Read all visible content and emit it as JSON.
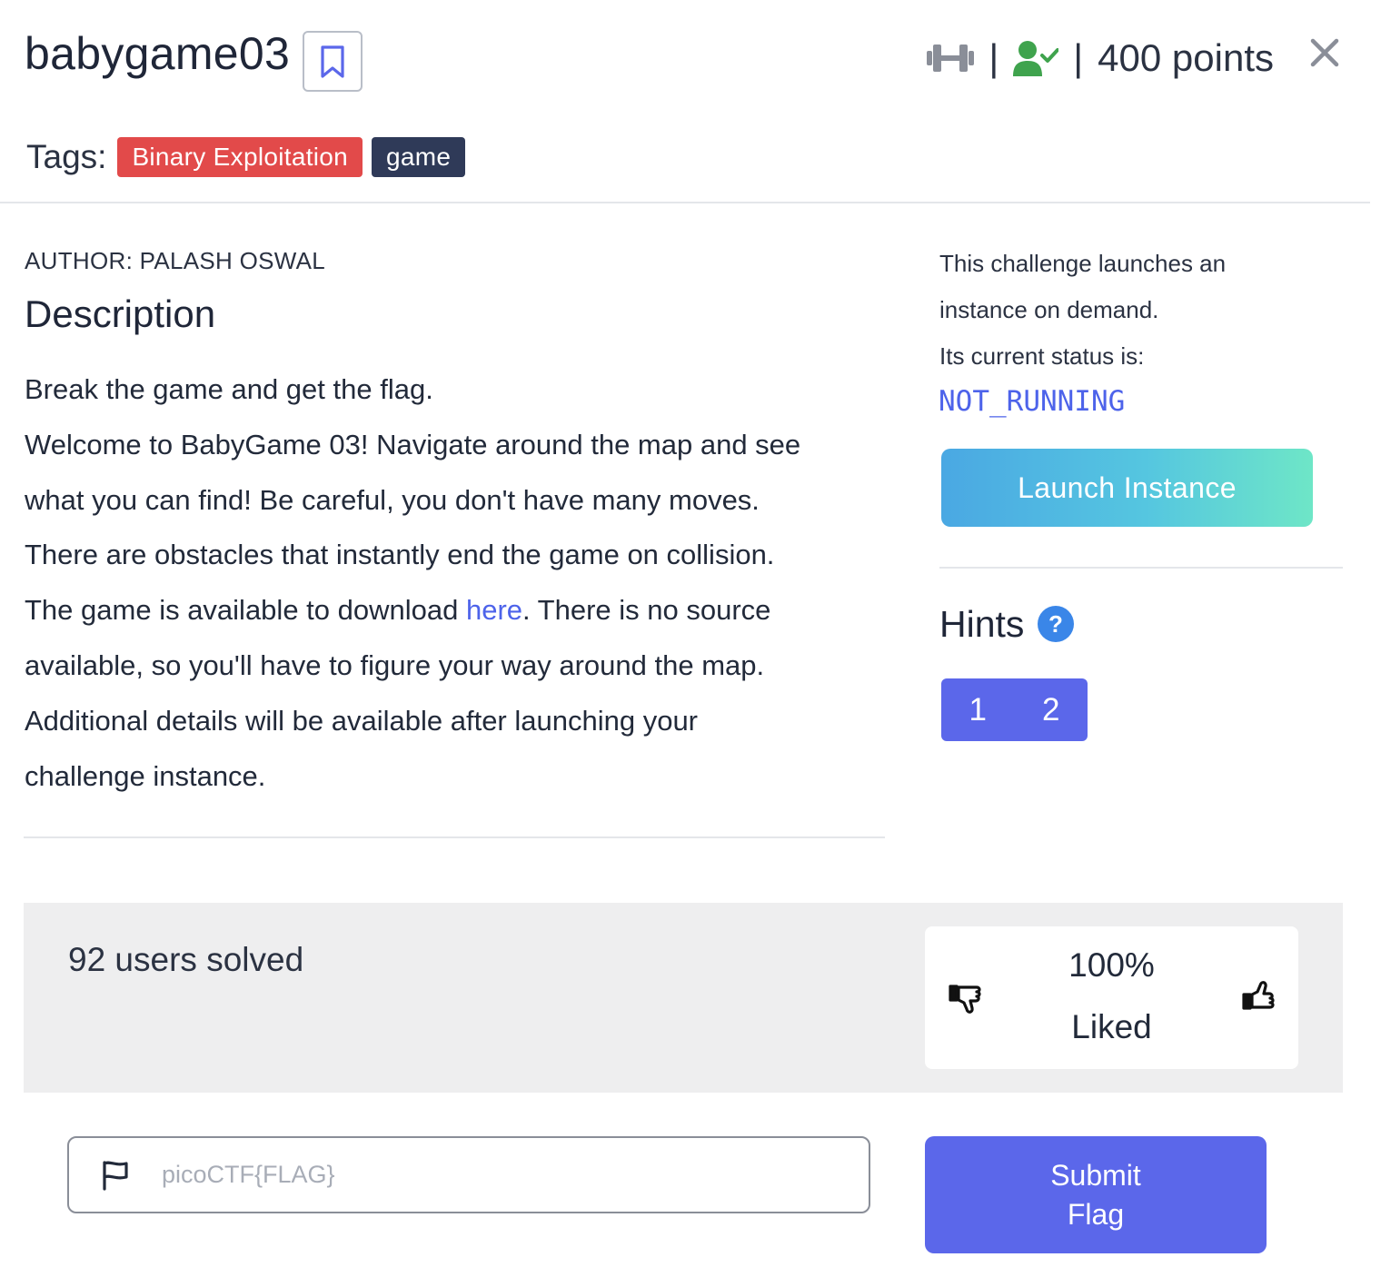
{
  "challenge": {
    "title": "babygame03",
    "points": "400 points",
    "separator": "|"
  },
  "tags": {
    "label": "Tags:",
    "items": [
      "Binary Exploitation",
      "game"
    ],
    "colors": [
      "#e24a4a",
      "#2f3a58"
    ]
  },
  "description": {
    "author": "AUTHOR: PALASH OSWAL",
    "heading": "Description",
    "line1": "Break the game and get the flag.",
    "line2": "Welcome to BabyGame 03! Navigate around the map and see",
    "line3": "what you can find! Be careful, you don't have many moves.",
    "line4": "There are obstacles that instantly end the game on collision.",
    "line5_before_link": "The game is available to download ",
    "link_text": "here",
    "line5_after_link": ". There is no source",
    "line6": "available, so you'll have to figure your way around the map.",
    "line7": "Additional details will be available after launching your",
    "line8": "challenge instance."
  },
  "instance": {
    "text_line1": "This challenge launches an",
    "text_line2": "instance on demand.",
    "text_line3": "Its current status is:",
    "status": "NOT_RUNNING",
    "launch_label": "Launch Instance"
  },
  "hints": {
    "heading": "Hints",
    "help_glyph": "?",
    "items": [
      "1",
      "2"
    ]
  },
  "stats": {
    "solved": "92 users solved",
    "liked_percent": "100%",
    "liked_label": "Liked"
  },
  "flag": {
    "placeholder": "picoCTF{FLAG}",
    "value": "",
    "submit_line1": "Submit",
    "submit_line2": "Flag"
  },
  "icons": {
    "difficulty": "dumbbell-icon",
    "solved_status": "user-check-icon",
    "close": "close-icon",
    "bookmark": "bookmark-icon",
    "thumb_down": "thumbs-down-icon",
    "thumb_up": "thumbs-up-icon",
    "flag": "flag-icon"
  },
  "colors": {
    "accent": "#5b67ea",
    "link": "#4d63ea",
    "solved_green": "#3fa34d",
    "muted_icon": "#8a8e98"
  }
}
